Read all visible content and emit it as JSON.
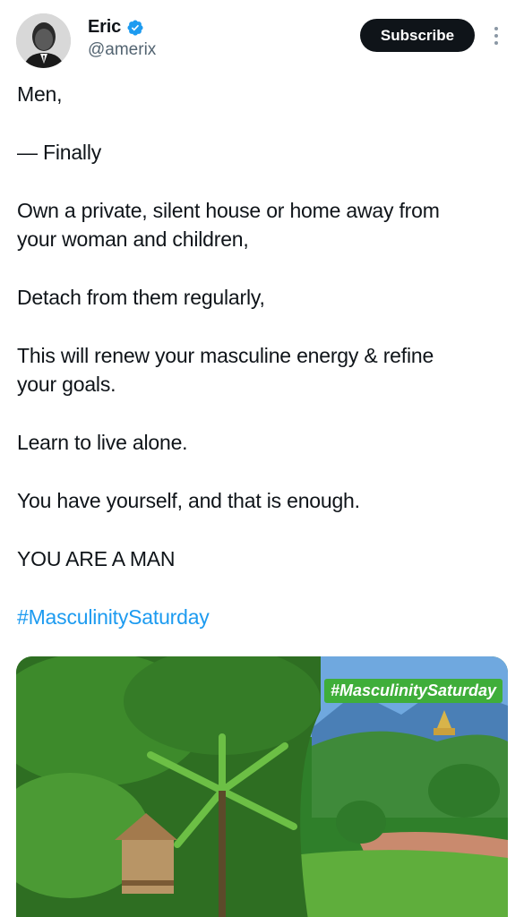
{
  "author": {
    "display_name": "Eric",
    "handle": "@amerix",
    "verified": true
  },
  "actions": {
    "subscribe_label": "Subscribe",
    "more_icon": "more-vertical-icon"
  },
  "tweet": {
    "lines": [
      "Men,",
      "— Finally",
      "Own a private, silent house or home away from",
      "your woman and children,",
      "Detach from them regularly,",
      "This will renew your masculine energy & refine",
      "your goals.",
      "Learn to live alone.",
      "You have yourself, and that is enough.",
      "YOU ARE A MAN"
    ],
    "hashtag": "#MasculinitySaturday"
  },
  "media": {
    "overlay_tag": "#MasculinitySaturday"
  },
  "colors": {
    "link": "#1d9bf0",
    "verified": "#1d9bf0",
    "button_bg": "#0f1419",
    "tag_bg": "#3fae3a"
  }
}
